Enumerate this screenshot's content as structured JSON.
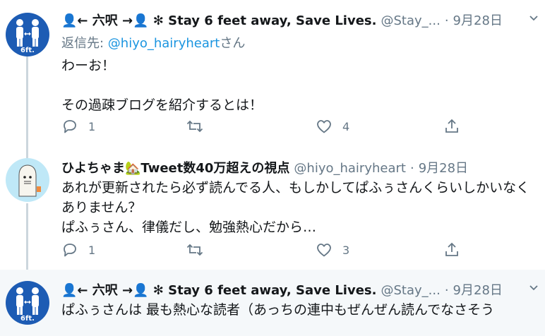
{
  "tweets": [
    {
      "name": "👤← 六呎 →👤 ✻ Stay 6 feet away, Save Lives.",
      "handle": "@Stay_...",
      "dot": "·",
      "date": "9月28日",
      "replying_prefix": "返信先: ",
      "replying_handle": "@hiyo_hairyheart",
      "replying_suffix": "さん",
      "text": "わーお！\n\nその過疎ブログを紹介するとは！",
      "avatar_label": "6ft.",
      "replies": "1",
      "retweets": "",
      "likes": "4"
    },
    {
      "name": "ひよちゃま🏡Tweet数40万超えの視点",
      "handle": "@hiyo_hairyheart",
      "dot": "·",
      "date": "9月28日",
      "text": "あれが更新されたら必ず読んでる人、もしかしてぱふぅさんくらいしかいなくありません？\nぱふぅさん、律儀だし、勉強熱心だから…",
      "replies": "1",
      "retweets": "",
      "likes": "3"
    },
    {
      "name": "👤← 六呎 →👤 ✻ Stay 6 feet away, Save Lives.",
      "handle": "@Stay_...",
      "dot": "·",
      "date": "9月28日",
      "text": "ぱふぅさんは 最も熱心な読者（あっちの連中もぜんぜん読んでなさそう",
      "avatar_label": "6ft."
    }
  ],
  "colors": {
    "link": "#1b95e0",
    "muted": "#657786",
    "thread_line": "#ccd6dd",
    "avatar_blue": "#1d5cb4",
    "highlight_bg": "#f5f8fa"
  },
  "icons": [
    "reply-icon",
    "retweet-icon",
    "like-icon",
    "share-icon",
    "caret-down-icon",
    "six-feet-icon",
    "ghost-avatar"
  ]
}
